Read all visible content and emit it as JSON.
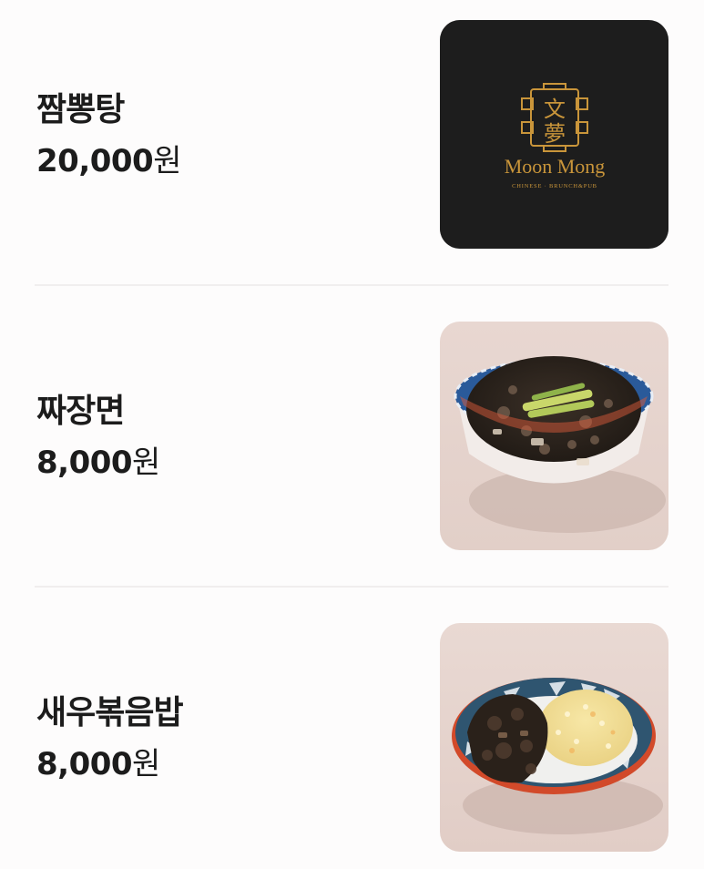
{
  "menu": {
    "items": [
      {
        "name": "짬뽕탕",
        "price": "20,000",
        "currency": "원",
        "image": "moon-mong-logo",
        "logo": {
          "hanja_top": "文",
          "hanja_bottom": "夢",
          "brand": "Moon Mong",
          "tagline": "CHINESE · BRUNCH&PUB"
        }
      },
      {
        "name": "짜장면",
        "price": "8,000",
        "currency": "원",
        "image": "jajangmyeon-photo"
      },
      {
        "name": "새우볶음밥",
        "price": "8,000",
        "currency": "원",
        "image": "shrimp-fried-rice-photo"
      }
    ]
  },
  "colors": {
    "background": "#fdfcfc",
    "text": "#1c1c1c",
    "divider": "#f0eeee",
    "logo_gold": "#c9953a",
    "logo_bg": "#1b1b1b"
  }
}
